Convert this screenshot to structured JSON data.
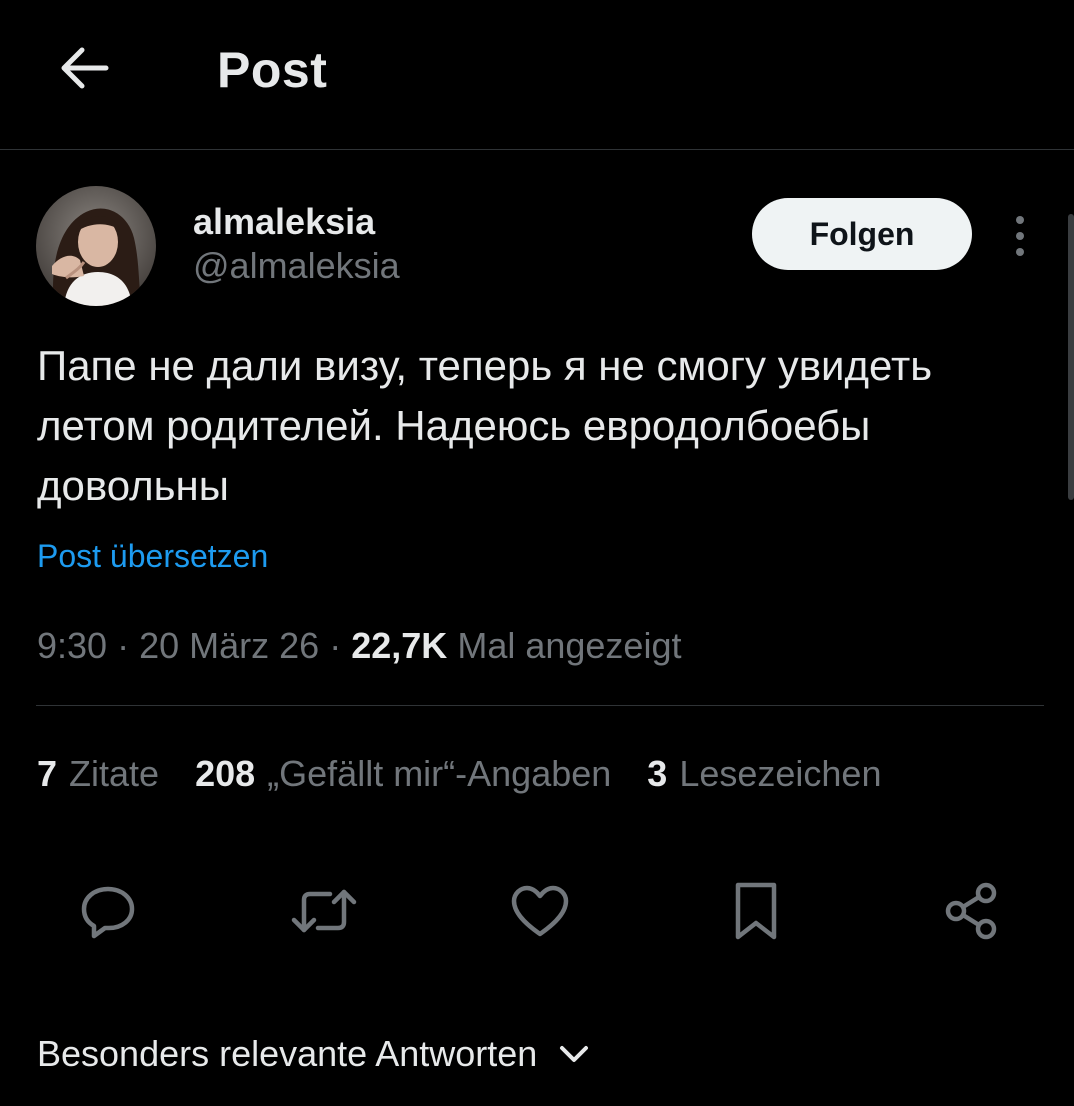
{
  "header": {
    "title": "Post"
  },
  "author": {
    "display_name": "almaleksia",
    "handle": "@almaleksia"
  },
  "follow_label": "Folgen",
  "post": {
    "text": "Папе не дали визу, теперь я не смогу увидеть летом родителей. Надеюсь евродолбоебы довольны",
    "translate_label": "Post übersetzen"
  },
  "meta": {
    "time": "9:30",
    "date": "20 März 26",
    "views": "22,7K",
    "views_label": "Mal angezeigt",
    "separator": "·"
  },
  "stats": {
    "quotes_count": "7",
    "quotes_label": "Zitate",
    "likes_count": "208",
    "likes_label": "„Gefällt mir“-Angaben",
    "bookmarks_count": "3",
    "bookmarks_label": "Lesezeichen"
  },
  "actions": [
    "reply-icon",
    "repost-icon",
    "like-icon",
    "bookmark-icon",
    "share-icon"
  ],
  "replies": {
    "sort_label": "Besonders relevante Antworten"
  },
  "colors": {
    "background": "#000000",
    "text": "#e7e9ea",
    "muted": "#71767b",
    "link": "#1d9bf0",
    "divider": "#2f3336",
    "follow_bg": "#eff3f4"
  }
}
